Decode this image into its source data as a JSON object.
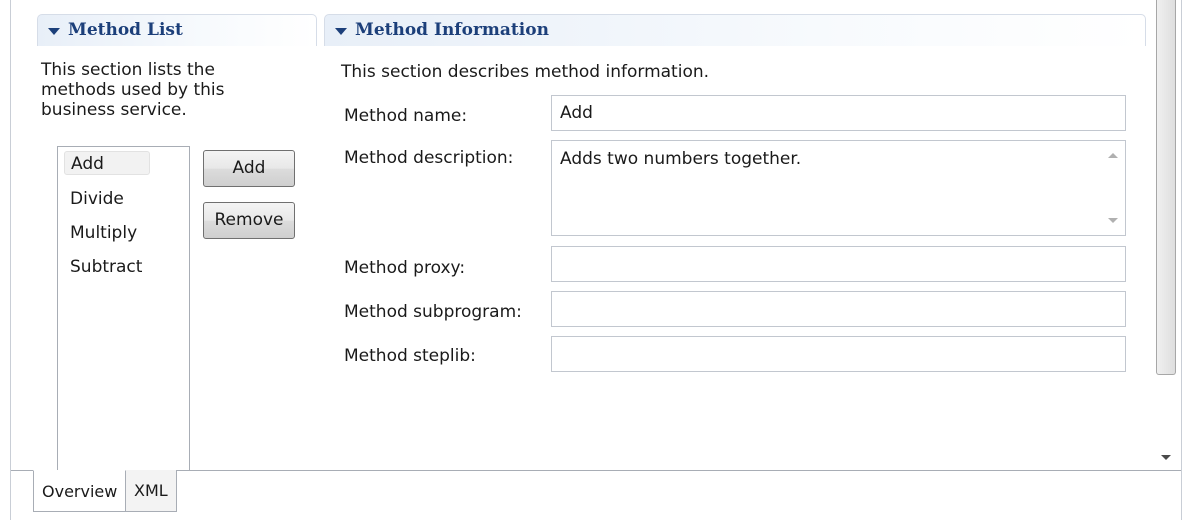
{
  "method_list": {
    "title": "Method List",
    "description": "This section lists the methods used by this business service.",
    "description_lines": [
      "This section lists the",
      "methods used by this",
      "business service."
    ],
    "items": [
      "Add",
      "Divide",
      "Multiply",
      "Subtract"
    ],
    "selected": "Add",
    "add_button": "Add",
    "remove_button": "Remove"
  },
  "method_info": {
    "title": "Method Information",
    "description": "This section describes method information.",
    "fields": {
      "name": {
        "label": "Method name:",
        "value": "Add"
      },
      "description": {
        "label": "Method description:",
        "value": "Adds two numbers together."
      },
      "proxy": {
        "label": "Method proxy:",
        "value": ""
      },
      "subprogram": {
        "label": "Method subprogram:",
        "value": ""
      },
      "steplib": {
        "label": "Method steplib:",
        "value": ""
      }
    }
  },
  "tabs": [
    {
      "label": "Overview",
      "active": true
    },
    {
      "label": "XML",
      "active": false
    }
  ],
  "colors": {
    "section_title": "#1c3f7a",
    "header_gradient_start": "#e8eff8",
    "border": "#a8adb5"
  },
  "icons": {
    "section_toggle": "triangle-down-icon",
    "scroll_up": "scroll-up-arrow-icon",
    "scroll_down": "scroll-down-arrow-icon"
  }
}
